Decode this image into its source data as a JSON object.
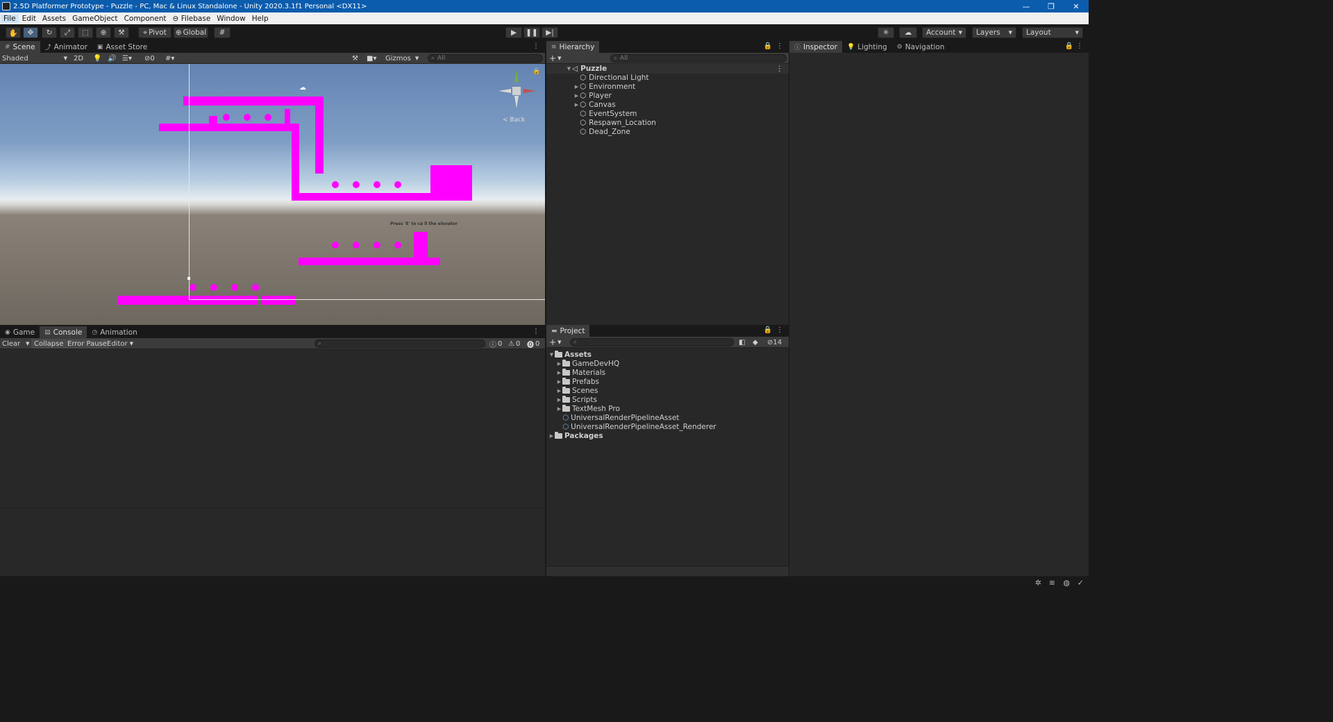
{
  "window": {
    "title": "2.5D Platformer Prototype - Puzzle - PC, Mac & Linux Standalone - Unity 2020.3.1f1 Personal <DX11>",
    "minimize": "—",
    "restore": "❐",
    "close": "✕"
  },
  "menu": [
    "File",
    "Edit",
    "Assets",
    "GameObject",
    "Component",
    "Filebase",
    "Window",
    "Help"
  ],
  "toolbar": {
    "pivot": "Pivot",
    "global": "Global",
    "account": "Account",
    "layers": "Layers",
    "layout": "Layout"
  },
  "scene_panel": {
    "tabs": [
      "Scene",
      "Animator",
      "Asset Store"
    ],
    "shading": "Shaded",
    "mode_2d": "2D",
    "hidden_count": "0",
    "gizmos": "Gizmos",
    "search_placeholder": "All",
    "gizmo_label": "< Back",
    "prompt_text": "Press 'E' to ca ll the elevator"
  },
  "console_panel": {
    "tabs": [
      "Game",
      "Console",
      "Animation"
    ],
    "clear": "Clear",
    "collapse": "Collapse",
    "error_pause": "Error Pause",
    "editor": "Editor",
    "info_count": "0",
    "warning_count": "0",
    "error_count": "0"
  },
  "hierarchy": {
    "tab": "Hierarchy",
    "search_placeholder": "All",
    "scene": "Puzzle",
    "items": [
      {
        "label": "Directional Light",
        "expandable": false
      },
      {
        "label": "Environment",
        "expandable": true
      },
      {
        "label": "Player",
        "expandable": true
      },
      {
        "label": "Canvas",
        "expandable": true
      },
      {
        "label": "EventSystem",
        "expandable": false
      },
      {
        "label": "Respawn_Location",
        "expandable": false
      },
      {
        "label": "Dead_Zone",
        "expandable": false
      }
    ]
  },
  "project": {
    "tab": "Project",
    "hidden_count": "14",
    "root": "Assets",
    "folders": [
      "GameDevHQ",
      "Materials",
      "Prefabs",
      "Scenes",
      "Scripts",
      "TextMesh Pro"
    ],
    "files": [
      "UniversalRenderPipelineAsset",
      "UniversalRenderPipelineAsset_Renderer"
    ],
    "packages": "Packages"
  },
  "inspector": {
    "tabs": [
      "Inspector",
      "Lighting",
      "Navigation"
    ]
  },
  "colors": {
    "accent_blue": "#0b5cad",
    "magenta": "#ff00ff",
    "panel": "#282828"
  }
}
